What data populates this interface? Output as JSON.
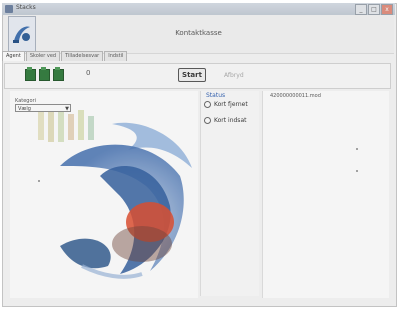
{
  "window": {
    "title": "Stacks",
    "minimize": "_",
    "maximize": "□",
    "close": "x"
  },
  "header": {
    "title": "Kontaktkasse",
    "app_icon": "app-icon"
  },
  "tabs": [
    {
      "label": "Agent",
      "active": true
    },
    {
      "label": "Skoler ved",
      "active": false
    },
    {
      "label": "Tilladelsesvar",
      "active": false
    },
    {
      "label": "Indstil",
      "active": false
    }
  ],
  "toolbar": {
    "counter": "0",
    "start_label": "Start",
    "stop_label": "Afbryd"
  },
  "category": {
    "label": "Kategori",
    "selected": "Vælg"
  },
  "status": {
    "title": "Status",
    "options": [
      "Kort fjernet",
      "Kort indsat"
    ]
  },
  "log": {
    "header": "420000000011.mod"
  },
  "colors": {
    "accent": "#2f5fb2",
    "stack_green": "#2f7a3a"
  }
}
